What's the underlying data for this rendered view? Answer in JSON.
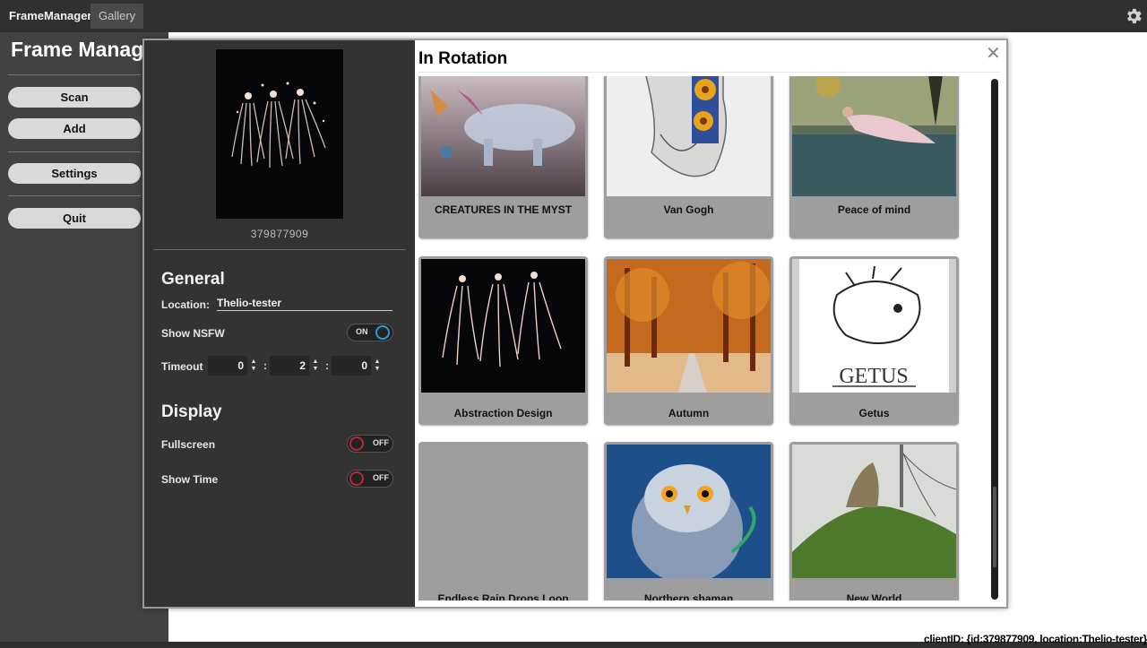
{
  "topbar": {
    "tabs": [
      {
        "label": "FrameManager"
      },
      {
        "label": "Gallery"
      }
    ],
    "settings_icon": "gear-icon"
  },
  "sidebar": {
    "title": "Frame Manager",
    "buttons": [
      {
        "label": "Scan"
      },
      {
        "label": "Add"
      },
      {
        "label": "Settings"
      },
      {
        "label": "Quit"
      }
    ]
  },
  "modal": {
    "preview_id": "379877909",
    "general": {
      "heading": "General",
      "location_label": "Location:",
      "location_value": "Thelio-tester",
      "nsfw_label": "Show NSFW",
      "nsfw_state": "ON",
      "timeout_label": "Timeout",
      "timeout_h": "0",
      "timeout_m": "2",
      "timeout_s": "0",
      "sep": ":"
    },
    "display": {
      "heading": "Display",
      "fullscreen_label": "Fullscreen",
      "fullscreen_state": "OFF",
      "showtime_label": "Show Time",
      "showtime_state": "OFF"
    },
    "rotation": {
      "title": "In Rotation",
      "close_icon": "close-icon",
      "items": [
        {
          "caption": "CREATURES IN THE MYST"
        },
        {
          "caption": "Van Gogh"
        },
        {
          "caption": "Peace of mind"
        },
        {
          "caption": "Abstraction Design"
        },
        {
          "caption": "Autumn"
        },
        {
          "caption": "Getus"
        },
        {
          "caption": "Endless Rain Drops Loop"
        },
        {
          "caption": "Northern shaman"
        },
        {
          "caption": "New World"
        }
      ],
      "getus_text": "GETUS",
      "scroll_position_fraction": 0.92
    }
  },
  "status": {
    "client_id": "clientID: {id:379877909, location:Thelio-tester}"
  },
  "colors": {
    "topbar": "#303030",
    "sidebar": "#424242",
    "panel": "#333333",
    "card": "#9e9e9e",
    "toggle_on": "#2f9bd6",
    "toggle_off": "#b42a3c"
  }
}
